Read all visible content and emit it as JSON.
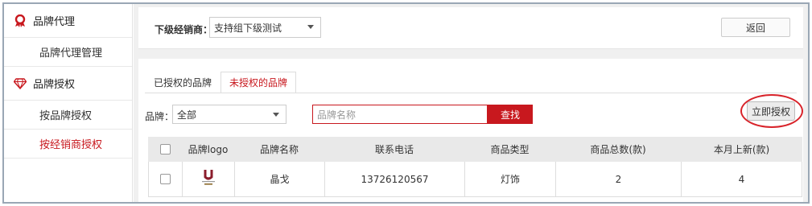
{
  "sidebar": {
    "sections": [
      {
        "title": "品牌代理",
        "icon": "award-ribbon-icon",
        "items": [
          {
            "label": "品牌代理管理",
            "active": false
          }
        ]
      },
      {
        "title": "品牌授权",
        "icon": "diamond-icon",
        "items": [
          {
            "label": "按品牌授权",
            "active": false
          },
          {
            "label": "按经销商授权",
            "active": true
          }
        ]
      }
    ]
  },
  "topbar": {
    "dealer_label": "下级经销商：",
    "dealer_value": "支持组下级测试",
    "back_label": "返回"
  },
  "tabs": [
    {
      "label": "已授权的品牌",
      "active": false
    },
    {
      "label": "未授权的品牌",
      "active": true
    }
  ],
  "filter": {
    "brand_label": "品牌：",
    "brand_value": "全部",
    "search_placeholder": "品牌名称",
    "search_button": "查找",
    "authorize_button": "立即授权"
  },
  "table": {
    "headers": [
      "品牌logo",
      "品牌名称",
      "联系电话",
      "商品类型",
      "商品总数(款)",
      "本月上新(款)"
    ],
    "rows": [
      {
        "logo": "brand-logo-icon",
        "name": "晶戈",
        "phone": "13726120567",
        "type": "灯饰",
        "total": "2",
        "new": "4"
      }
    ]
  },
  "colors": {
    "accent": "#c8181e",
    "border": "#dddddd",
    "header_bg": "#e9e9e9",
    "page_bg": "#f0f0f0"
  }
}
